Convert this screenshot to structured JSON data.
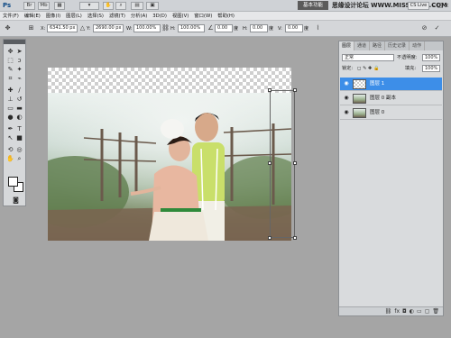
{
  "titlebar": {
    "app_logo": "Ps",
    "essentials": "基本功能",
    "watermark": "思缘设计论坛 WWW.MISSYUAN.COM",
    "cs_live": "CS Live",
    "icons": [
      "br-icon",
      "mb-icon",
      "zoom-icon",
      "arrange-icon",
      "screen-mode-icon"
    ]
  },
  "menubar": {
    "items": [
      "文件(F)",
      "编辑(E)",
      "图像(I)",
      "图层(L)",
      "选择(S)",
      "滤镜(T)",
      "分析(A)",
      "3D(D)",
      "视图(V)",
      "窗口(W)",
      "帮助(H)"
    ]
  },
  "options": {
    "x_label": "X:",
    "x_value": "6341.50 px",
    "y_label": "Y:",
    "y_value": "2690.00 px",
    "w_label": "W:",
    "w_value": "100.00%",
    "h_label": "H:",
    "h_value": "100.00%",
    "angle_value": "0.00",
    "angle_unit": "度",
    "hskew_label": "H:",
    "hskew_value": "0.00",
    "vskew_label": "V:",
    "vskew_value": "0.00",
    "skew_unit": "度"
  },
  "layers_panel": {
    "tabs": [
      "图层",
      "通道",
      "路径",
      "历史记录",
      "动作"
    ],
    "active_tab": "图层",
    "blend_mode": "正常",
    "opacity_label": "不透明度:",
    "opacity_value": "100%",
    "lock_label": "锁定:",
    "fill_label": "填充:",
    "fill_value": "100%",
    "layers": [
      {
        "name": "图层 1",
        "selected": true
      },
      {
        "name": "图层 0 副本",
        "selected": false
      },
      {
        "name": "图层 0",
        "selected": false
      }
    ]
  },
  "colors": {
    "selected_layer": "#3d8ee8",
    "workspace": "#a5a5a5"
  }
}
